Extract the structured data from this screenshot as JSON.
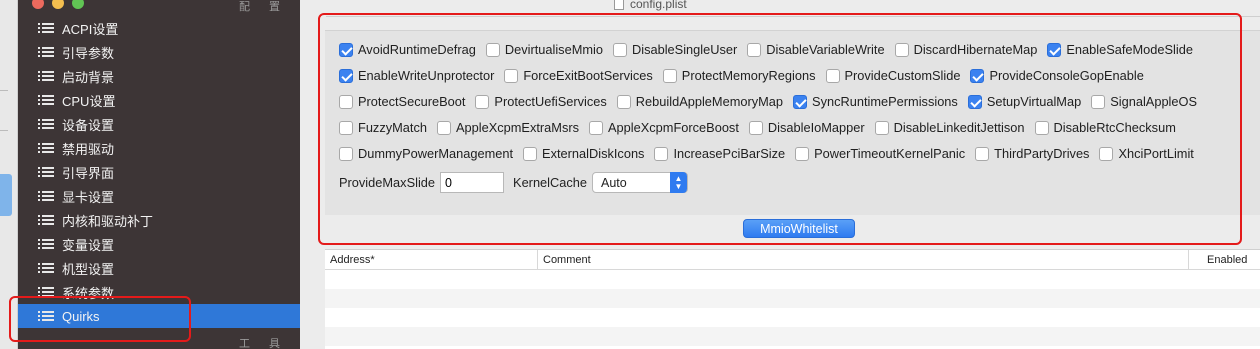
{
  "window": {
    "title": "config.plist",
    "sidebar_top_right": "配 置",
    "sidebar_footer": "工 具"
  },
  "sidebar": {
    "items": [
      {
        "label": "ACPI设置"
      },
      {
        "label": "引导参数"
      },
      {
        "label": "启动背景"
      },
      {
        "label": "CPU设置"
      },
      {
        "label": "设备设置"
      },
      {
        "label": "禁用驱动"
      },
      {
        "label": "引导界面"
      },
      {
        "label": "显卡设置"
      },
      {
        "label": "内核和驱动补丁"
      },
      {
        "label": "变量设置"
      },
      {
        "label": "机型设置"
      },
      {
        "label": "系统参数"
      },
      {
        "label": "Quirks",
        "selected": true
      }
    ]
  },
  "quirks": {
    "rows": [
      [
        {
          "label": "AvoidRuntimeDefrag",
          "checked": true
        },
        {
          "label": "DevirtualiseMmio",
          "checked": false
        },
        {
          "label": "DisableSingleUser",
          "checked": false
        },
        {
          "label": "DisableVariableWrite",
          "checked": false
        },
        {
          "label": "DiscardHibernateMap",
          "checked": false
        },
        {
          "label": "EnableSafeModeSlide",
          "checked": true
        }
      ],
      [
        {
          "label": "EnableWriteUnprotector",
          "checked": true
        },
        {
          "label": "ForceExitBootServices",
          "checked": false
        },
        {
          "label": "ProtectMemoryRegions",
          "checked": false
        },
        {
          "label": "ProvideCustomSlide",
          "checked": false
        },
        {
          "label": "ProvideConsoleGopEnable",
          "checked": true
        }
      ],
      [
        {
          "label": "ProtectSecureBoot",
          "checked": false
        },
        {
          "label": "ProtectUefiServices",
          "checked": false
        },
        {
          "label": "RebuildAppleMemoryMap",
          "checked": false
        },
        {
          "label": "SyncRuntimePermissions",
          "checked": true
        },
        {
          "label": "SetupVirtualMap",
          "checked": true
        },
        {
          "label": "SignalAppleOS",
          "checked": false
        }
      ],
      [
        {
          "label": "FuzzyMatch",
          "checked": false
        },
        {
          "label": "AppleXcpmExtraMsrs",
          "checked": false
        },
        {
          "label": "AppleXcpmForceBoost",
          "checked": false
        },
        {
          "label": "DisableIoMapper",
          "checked": false
        },
        {
          "label": "DisableLinkeditJettison",
          "checked": false
        },
        {
          "label": "DisableRtcChecksum",
          "checked": false
        }
      ],
      [
        {
          "label": "DummyPowerManagement",
          "checked": false
        },
        {
          "label": "ExternalDiskIcons",
          "checked": false
        },
        {
          "label": "IncreasePciBarSize",
          "checked": false
        },
        {
          "label": "PowerTimeoutKernelPanic",
          "checked": false
        },
        {
          "label": "ThirdPartyDrives",
          "checked": false
        },
        {
          "label": "XhciPortLimit",
          "checked": false
        }
      ]
    ],
    "provide_max_slide": {
      "label": "ProvideMaxSlide",
      "value": "0"
    },
    "kernel_cache": {
      "label": "KernelCache",
      "value": "Auto"
    }
  },
  "mmio": {
    "button_label": "MmioWhitelist",
    "columns": [
      "Address*",
      "Comment",
      "Enabled"
    ],
    "rows": []
  },
  "colors": {
    "sidebar_bg": "#3d3536",
    "selected": "#2f78d8",
    "checkbox_on": "#3b82f0",
    "annotation": "#e41a1a"
  }
}
